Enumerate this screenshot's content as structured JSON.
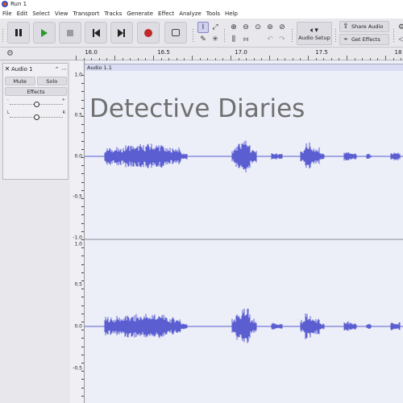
{
  "window": {
    "title": "Run 1"
  },
  "menu": [
    "File",
    "Edit",
    "Select",
    "View",
    "Transport",
    "Tracks",
    "Generate",
    "Effect",
    "Analyze",
    "Tools",
    "Help"
  ],
  "toolbar": {
    "audio_setup_label": "Audio Setup",
    "share_audio_label": "Share Audio",
    "get_effects_label": "Get Effects"
  },
  "ruler": {
    "ticks": [
      "16.0",
      "16.5",
      "17.0",
      "17.5",
      "18"
    ]
  },
  "track": {
    "name": "Audio 1",
    "mute_label": "Mute",
    "solo_label": "Solo",
    "effects_label": "Effects",
    "pan_left": "L",
    "pan_right": "R",
    "gain_minus": "-",
    "gain_plus": "+",
    "clip_name": "Audio 1.1"
  },
  "vruler": {
    "labels_top": [
      "1.0",
      "0.5",
      "0.0",
      "-0.5",
      "-1.0"
    ],
    "labels_bottom": [
      "1.0",
      "0.5",
      "0.0",
      "-0.5"
    ]
  },
  "overlay_text": "Detective Diaries",
  "colors": {
    "waveform": "#5a5ed0",
    "background": "#eceef8",
    "record": "#c0282a",
    "play": "#2e9a2e"
  }
}
